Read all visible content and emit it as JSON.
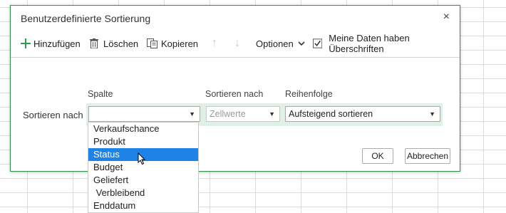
{
  "dialog": {
    "title": "Benutzerdefinierte Sortierung",
    "close_glyph": "×"
  },
  "toolbar": {
    "add_label": "Hinzufügen",
    "delete_label": "Löschen",
    "copy_label": "Kopieren",
    "up_glyph": "↑",
    "down_glyph": "↓",
    "options_label": "Optionen",
    "headers_label": "Meine Daten haben Überschriften",
    "headers_checked": true
  },
  "columns": {
    "column_header": "Spalte",
    "sort_on_header": "Sortieren nach",
    "order_header": "Reihenfolge"
  },
  "row": {
    "label": "Sortieren nach",
    "column_value": "",
    "sort_on_value": "Zellwerte",
    "order_value": "Aufsteigend sortieren"
  },
  "buttons": {
    "ok": "OK",
    "cancel": "Abbrechen"
  },
  "dropdown": {
    "options": [
      "Verkaufschance",
      "Produkt",
      "Status",
      "Budget",
      "Geliefert",
      " Verbleibend",
      "Enddatum"
    ],
    "highlighted": "Status"
  },
  "colors": {
    "accent_green": "#2f8f4e",
    "row_band": "#dff0e6",
    "highlight_blue": "#1e82e6"
  }
}
